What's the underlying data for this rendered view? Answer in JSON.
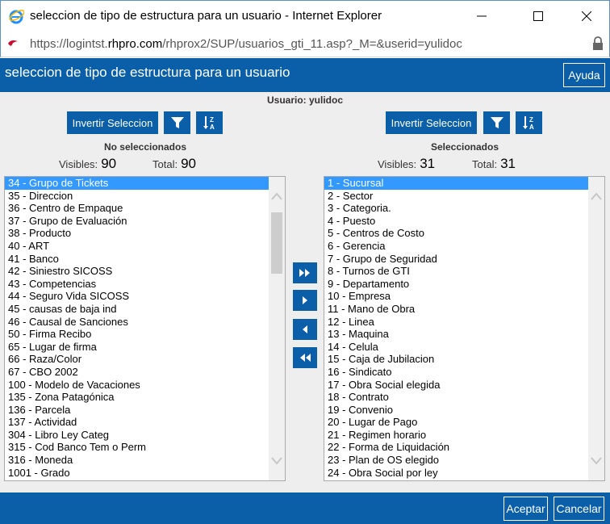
{
  "window": {
    "title": "seleccion de tipo de estructura para un usuario - Internet Explorer",
    "url_prefix": "https://logintst.",
    "url_domain": "rhpro.com",
    "url_path": "/rhprox2/SUP/usuarios_gti_11.asp?_M=&userid=yulidoc"
  },
  "header": {
    "title": "seleccion de tipo de estructura para un usuario",
    "help_label": "Ayuda"
  },
  "user_line": "Usuario: yulidoc",
  "left_panel": {
    "invert_label": "Invertir Seleccion",
    "heading": "No seleccionados",
    "visible_label": "Visibles:",
    "visible_count": "90",
    "total_label": "Total:",
    "total_count": "90",
    "items": [
      "34 - Grupo de Tickets",
      "35 - Direccion",
      "36 - Centro de Empaque",
      "37 - Grupo de Evaluación",
      "38 - Producto",
      "40 - ART",
      "41 - Banco",
      "42 - Siniestro SICOSS",
      "43 - Competencias",
      "44 - Seguro Vida SICOSS",
      "45 - causas de baja ind",
      "46 - Causal de Sanciones",
      "50 - Firma Recibo",
      "65 - Lugar de firma",
      "66 - Raza/Color",
      "67 - CBO 2002",
      "100 - Modelo de Vacaciones",
      "135 - Zona Patagónica",
      "136 - Parcela",
      "137 - Actividad",
      "304 - Libro Ley Categ",
      "315 - Cod Banco Tem o Perm",
      "316 - Moneda",
      "1001 - Grado"
    ]
  },
  "right_panel": {
    "invert_label": "Invertir Seleccion",
    "heading": "Seleccionados",
    "visible_label": "Visibles:",
    "visible_count": "31",
    "total_label": "Total:",
    "total_count": "31",
    "items": [
      "1 - Sucursal",
      "2 - Sector",
      "3 - Categoria.",
      "4 - Puesto",
      "5 - Centros de Costo",
      "6 - Gerencia",
      "7 - Grupo de Seguridad",
      "8 - Turnos de GTI",
      "9 - Departamento",
      "10 - Empresa",
      "11 - Mano de Obra",
      "12 - Linea",
      "13 - Maquina",
      "14 - Celula",
      "15 - Caja de Jubilacion",
      "16 - Sindicato",
      "17 - Obra Social elegida",
      "18 - Contrato",
      "19 - Convenio",
      "20 - Lugar de Pago",
      "21 - Regimen horario",
      "22 - Forma de Liquidación",
      "23 - Plan de OS elegido",
      "24 - Obra Social por ley"
    ]
  },
  "footer": {
    "accept_label": "Aceptar",
    "cancel_label": "Cancelar"
  },
  "icons": {
    "filter": "filter-icon",
    "sort": "sort-az-icon",
    "move_all_right": "double-chevron-right-icon",
    "move_right": "chevron-right-icon",
    "move_left": "chevron-left-icon",
    "move_all_left": "double-chevron-left-icon"
  },
  "colors": {
    "accent": "#0a5fa8",
    "selection": "#3399ff",
    "content_bg": "#eeeeee"
  }
}
